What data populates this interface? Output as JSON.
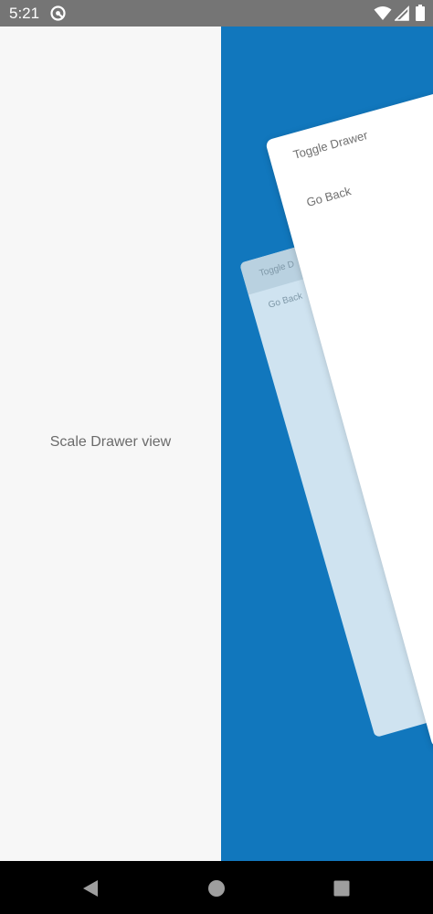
{
  "status_bar": {
    "time": "5:21",
    "app_icon": "at-sign-icon",
    "wifi_icon": "wifi-icon",
    "signal_icon": "cell-signal-icon",
    "battery_icon": "battery-icon"
  },
  "drawer": {
    "title": "Scale Drawer view"
  },
  "menu": {
    "items": [
      {
        "label": "Toggle Drawer"
      },
      {
        "label": "Go Back"
      }
    ]
  },
  "ghost_menu": {
    "items": [
      {
        "label": "Toggle D"
      },
      {
        "label": "Go Back"
      }
    ]
  },
  "nav_bar": {
    "back_icon": "back-triangle-icon",
    "home_icon": "home-circle-icon",
    "recents_icon": "recents-square-icon"
  },
  "colors": {
    "status_bar": "#757575",
    "drawer_background": "#f7f7f7",
    "content_background": "#1177bd",
    "ghost_card": "#cfe3f0",
    "card": "#ffffff",
    "nav_bar": "#000000"
  }
}
